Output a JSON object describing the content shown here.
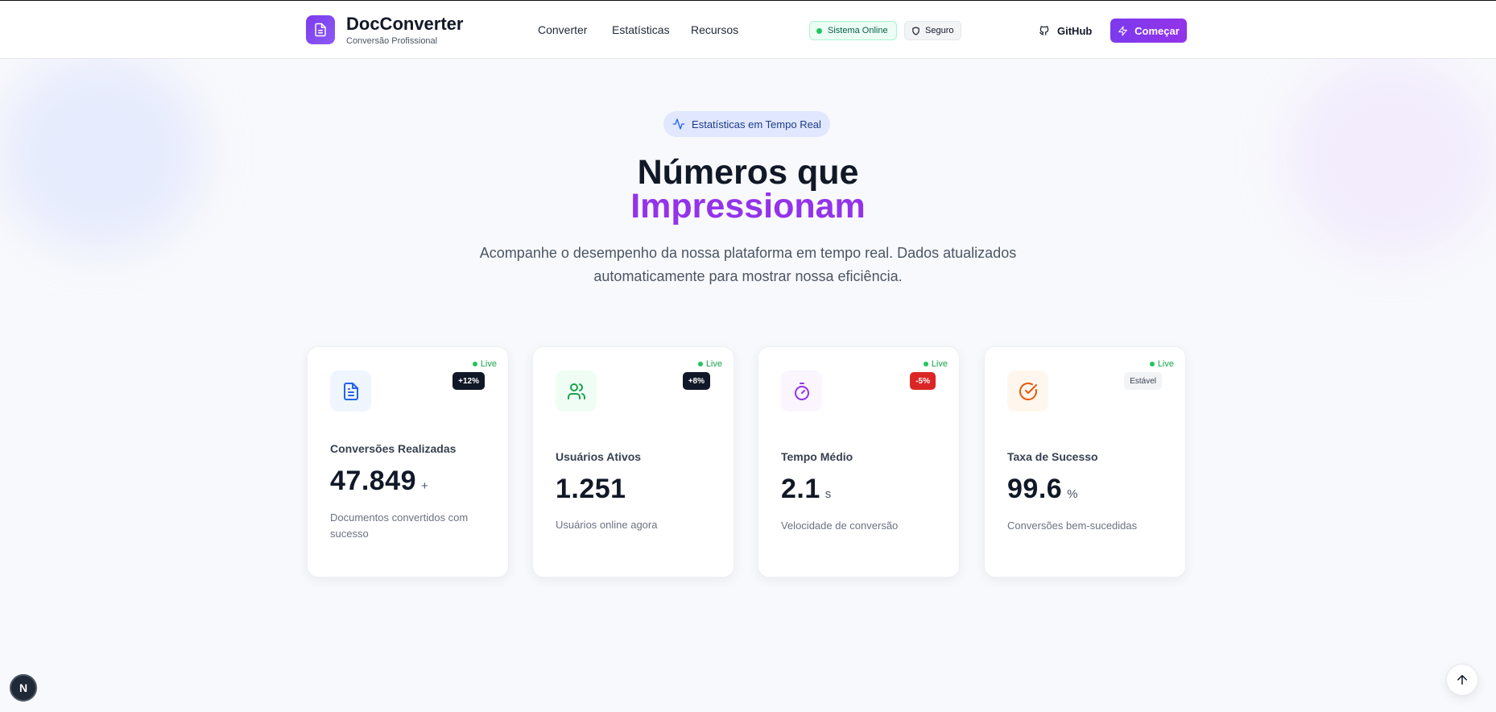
{
  "header": {
    "brand_title": "DocConverter",
    "brand_subtitle": "Conversão Profissional",
    "nav": [
      {
        "label": "Converter"
      },
      {
        "label": "Estatísticas"
      },
      {
        "label": "Recursos"
      }
    ],
    "status_online": "Sistema Online",
    "status_secure": "Seguro",
    "github_label": "GitHub",
    "start_button": "Começar"
  },
  "hero": {
    "badge": "Estatísticas em Tempo Real",
    "title_line1": "Números que",
    "title_line2": "Impressionam",
    "description": "Acompanhe o desempenho da nossa plataforma em tempo real. Dados atualizados automaticamente para mostrar nossa eficiência."
  },
  "cards": [
    {
      "icon": "document-icon",
      "live": "Live",
      "change": "+12%",
      "change_color": "#111827",
      "label": "Conversões Realizadas",
      "value": "47.849",
      "suffix": "+",
      "description": "Documentos convertidos com sucesso",
      "accent": "#2563eb",
      "icon_bg": "#eff6ff"
    },
    {
      "icon": "users-icon",
      "live": "Live",
      "change": "+8%",
      "change_color": "#111827",
      "label": "Usuários Ativos",
      "value": "1.251",
      "suffix": "",
      "description": "Usuários online agora",
      "accent": "#16a34a",
      "icon_bg": "#f0fdf4"
    },
    {
      "icon": "timer-icon",
      "live": "Live",
      "change": "-5%",
      "change_color": "#dc2626",
      "label": "Tempo Médio",
      "value": "2.1",
      "suffix": "s",
      "description": "Velocidade de conversão",
      "accent": "#9333ea",
      "icon_bg": "#faf5ff"
    },
    {
      "icon": "check-circle-icon",
      "live": "Live",
      "change": "Estável",
      "change_color": "#f3f4f6",
      "label": "Taxa de Sucesso",
      "value": "99.6",
      "suffix": "%",
      "description": "Conversões bem-sucedidas",
      "accent": "#ea580c",
      "icon_bg": "#fff7ed"
    }
  ],
  "colors": {
    "primary": "#7c3aed",
    "accent_text": "#9333ea",
    "online_green": "#22c55e"
  },
  "floating": {
    "devtools_letter": "N"
  }
}
